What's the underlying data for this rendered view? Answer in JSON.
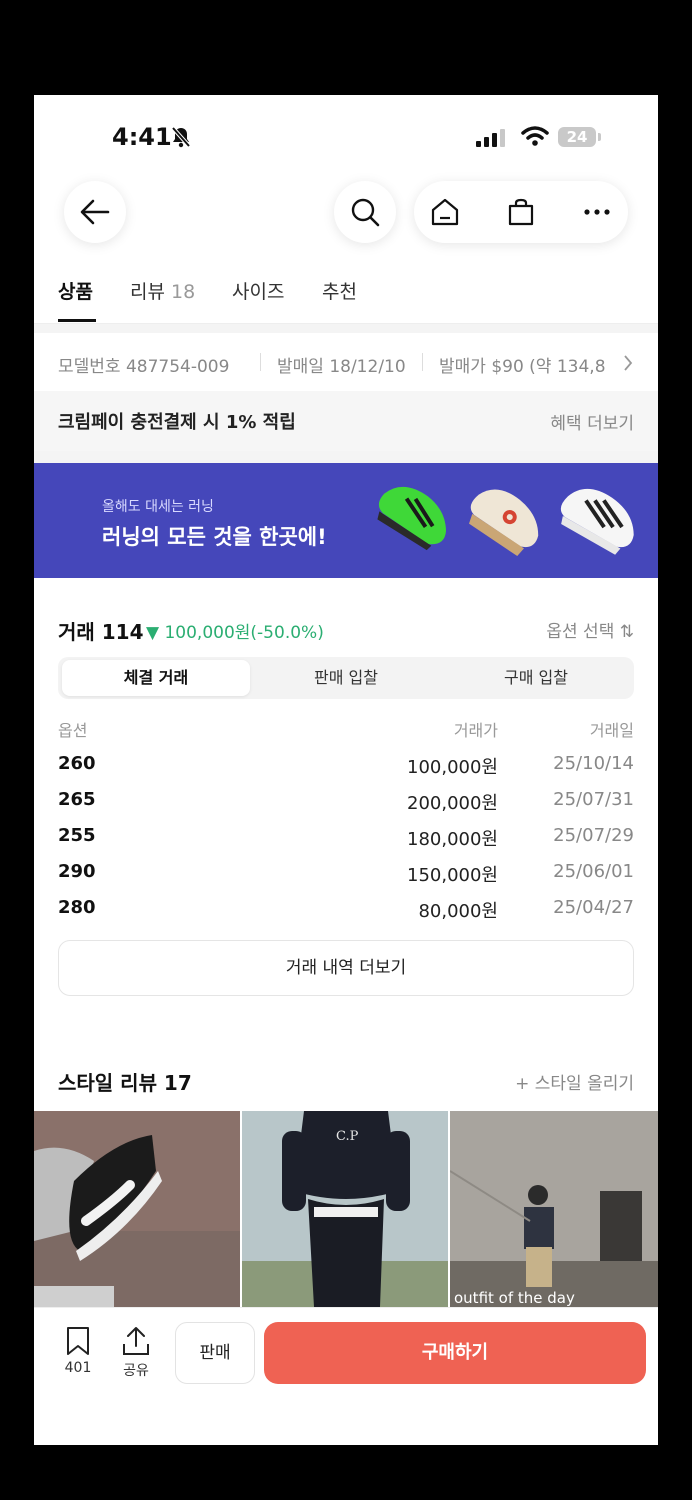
{
  "status": {
    "time": "4:41",
    "battery": "24"
  },
  "tabs": [
    {
      "label": "상품",
      "count": ""
    },
    {
      "label": "리뷰",
      "count": "18"
    },
    {
      "label": "사이즈",
      "count": ""
    },
    {
      "label": "추천",
      "count": ""
    }
  ],
  "product_info": {
    "model": "모델번호 487754-009",
    "release_date": "발매일 18/12/10",
    "release_price": "발매가 $90 (약 134,8"
  },
  "benefit": {
    "text": "크림페이 충전결제 시 1% 적립",
    "more": "혜택 더보기"
  },
  "banner": {
    "sub": "올해도 대세는 러닝",
    "main": "러닝의 모든 것을 한곳에!"
  },
  "trade": {
    "title": "거래 114",
    "change": "▼ 100,000원(-50.0%)",
    "option_select": "옵션 선택 ⇅",
    "segments": [
      "체결 거래",
      "판매 입찰",
      "구매 입찰"
    ],
    "headers": [
      "옵션",
      "거래가",
      "거래일"
    ],
    "rows": [
      {
        "size": "260",
        "price": "100,000원",
        "date": "25/10/14"
      },
      {
        "size": "265",
        "price": "200,000원",
        "date": "25/07/31"
      },
      {
        "size": "255",
        "price": "180,000원",
        "date": "25/07/29"
      },
      {
        "size": "290",
        "price": "150,000원",
        "date": "25/06/01"
      },
      {
        "size": "280",
        "price": "80,000원",
        "date": "25/04/27"
      }
    ],
    "more": "거래 내역 더보기"
  },
  "style_review": {
    "title": "스타일 리뷰 17",
    "upload": "+ 스타일 올리기",
    "photo_caption": "outfit of the day",
    "hoodie_text": "C.P"
  },
  "bottom_bar": {
    "bookmark_count": "401",
    "share_label": "공유",
    "sell_label": "판매",
    "buy_label": "구매하기"
  },
  "colors": {
    "buy": "#ef6253",
    "banner": "#4547ba",
    "down": "#2bae72"
  }
}
